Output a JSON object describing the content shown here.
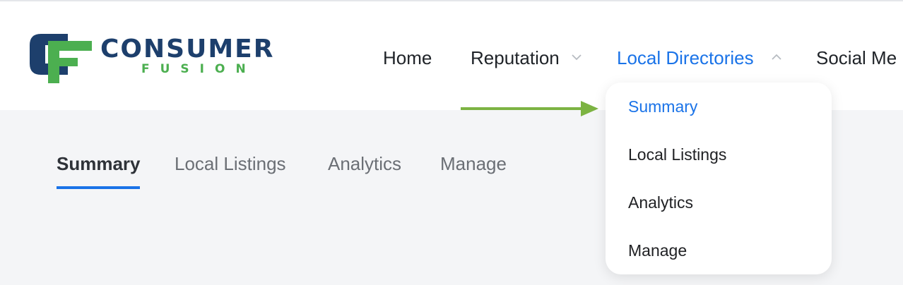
{
  "logo": {
    "line1": "CONSUMER",
    "line2": "FUSION",
    "colors": {
      "navy": "#1d3f6c",
      "green": "#4caf50"
    }
  },
  "nav": {
    "items": [
      {
        "label": "Home"
      },
      {
        "label": "Reputation",
        "icon": "chevron-down-icon"
      },
      {
        "label": "Local Directories",
        "icon": "chevron-up-icon",
        "active": true
      },
      {
        "label": "Social Me"
      }
    ]
  },
  "subtabs": {
    "items": [
      {
        "label": "Summary",
        "active": true
      },
      {
        "label": "Local Listings"
      },
      {
        "label": "Analytics"
      },
      {
        "label": "Manage"
      }
    ]
  },
  "dropdown": {
    "items": [
      {
        "label": "Summary",
        "active": true
      },
      {
        "label": "Local Listings"
      },
      {
        "label": "Analytics"
      },
      {
        "label": "Manage"
      }
    ]
  },
  "annotation": {
    "icon": "arrow-right-icon",
    "color": "#7cb342"
  },
  "colors": {
    "accent": "#1a73e8",
    "page_bg": "#f4f5f7"
  }
}
